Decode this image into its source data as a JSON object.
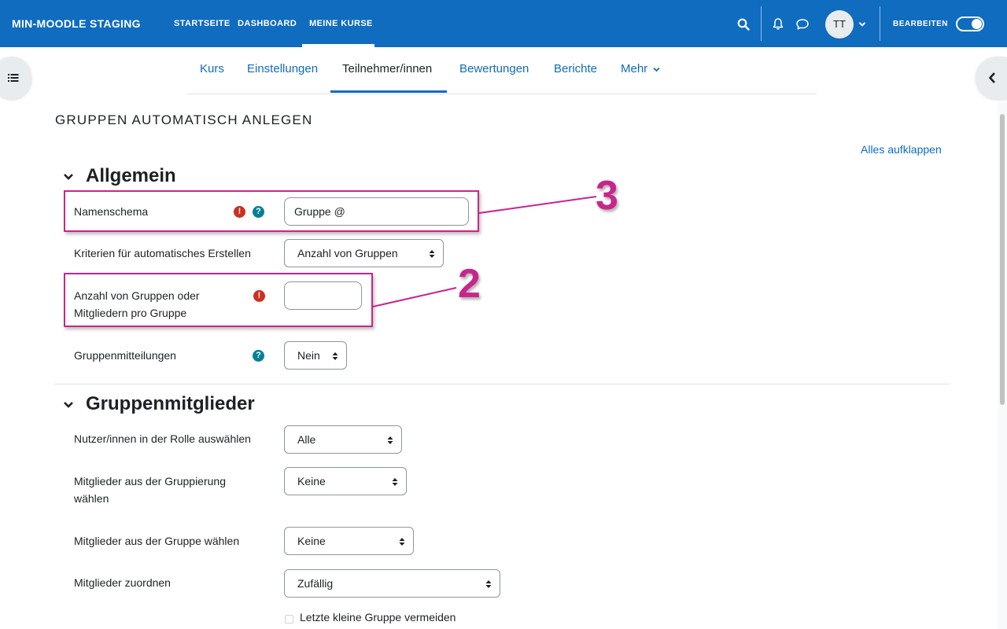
{
  "navbar": {
    "brand": "MIN-MOODLE STAGING",
    "links": [
      "STARTSEITE",
      "DASHBOARD",
      "MEINE KURSE"
    ],
    "avatar_initials": "TT",
    "edit_label": "BEARBEITEN",
    "edit_mode_on": true,
    "accent_color": "#0f6cbf"
  },
  "secondary_nav": {
    "items": [
      "Kurs",
      "Einstellungen",
      "Teilnehmer/innen",
      "Bewertungen",
      "Berichte",
      "Mehr"
    ],
    "active": "Teilnehmer/innen"
  },
  "page": {
    "title": "GRUPPEN AUTOMATISCH ANLEGEN",
    "expand_all": "Alles aufklappen"
  },
  "section_general": {
    "title": "Allgemein",
    "naming_scheme": {
      "label": "Namenschema",
      "value": "Gruppe @"
    },
    "criteria": {
      "label": "Kriterien für automatisches Erstellen",
      "value": "Anzahl von Gruppen"
    },
    "group_count": {
      "label_line1": "Anzahl von Gruppen oder",
      "label_line2": "Mitgliedern pro Gruppe",
      "value": ""
    },
    "group_messaging": {
      "label": "Gruppenmitteilungen",
      "value": "Nein"
    }
  },
  "section_members": {
    "title": "Gruppenmitglieder",
    "role": {
      "label": "Nutzer/innen in der Rolle auswählen",
      "value": "Alle"
    },
    "grouping": {
      "label_line1": "Mitglieder aus der Gruppierung",
      "label_line2": "wählen",
      "value": "Keine"
    },
    "group": {
      "label": "Mitglieder aus der Gruppe wählen",
      "value": "Keine"
    },
    "allocate": {
      "label": "Mitglieder zuordnen",
      "value": "Zufällig"
    },
    "avoid_small_group": {
      "label": "Letzte kleine Gruppe vermeiden",
      "checked": false
    }
  },
  "annotations": {
    "color": "#c8258d",
    "label_a": "3",
    "label_b": "2"
  }
}
